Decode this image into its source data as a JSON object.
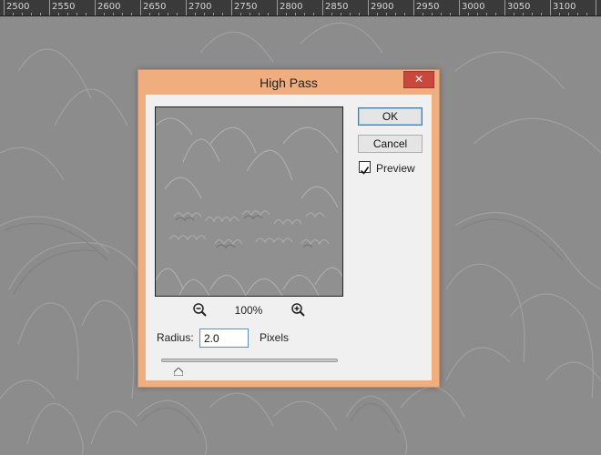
{
  "ruler": {
    "labels": [
      "2500",
      "2550",
      "2600",
      "2650",
      "2700",
      "2750",
      "2800",
      "2850",
      "2900",
      "2950",
      "3000",
      "3050",
      "3100"
    ]
  },
  "dialog": {
    "title": "High Pass",
    "close_glyph": "✕",
    "ok_label": "OK",
    "cancel_label": "Cancel",
    "preview": {
      "label": "Preview",
      "checked": true
    },
    "zoom_level": "100%",
    "zoom_out_icon": "zoom-out-icon",
    "zoom_in_icon": "zoom-in-icon",
    "radius": {
      "label": "Radius:",
      "value": "2.0",
      "units": "Pixels",
      "slider_fraction": 0.1
    }
  },
  "colors": {
    "titlebar": "#f0ad7d",
    "close_button": "#c9483e",
    "canvas": "#8b8c8b",
    "ruler": "#3a3a3a"
  }
}
